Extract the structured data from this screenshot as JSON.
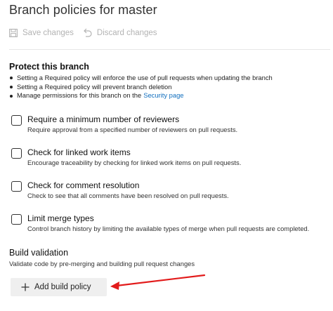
{
  "page": {
    "title": "Branch policies for master"
  },
  "toolbar": {
    "save_label": "Save changes",
    "save_icon": "save-icon",
    "discard_label": "Discard changes",
    "discard_icon": "undo-icon"
  },
  "protect": {
    "title": "Protect this branch",
    "bullets": [
      "Setting a Required policy will enforce the use of pull requests when updating the branch",
      "Setting a Required policy will prevent branch deletion",
      "Manage permissions for this branch on the"
    ],
    "security_link": "Security page"
  },
  "policies": [
    {
      "title": "Require a minimum number of reviewers",
      "description": "Require approval from a specified number of reviewers on pull requests.",
      "checked": false
    },
    {
      "title": "Check for linked work items",
      "description": "Encourage traceability by checking for linked work items on pull requests.",
      "checked": false
    },
    {
      "title": "Check for comment resolution",
      "description": "Check to see that all comments have been resolved on pull requests.",
      "checked": false
    },
    {
      "title": "Limit merge types",
      "description": "Control branch history by limiting the available types of merge when pull requests are completed.",
      "checked": false
    }
  ],
  "build": {
    "title": "Build validation",
    "description": "Validate code by pre-merging and building pull request changes",
    "add_label": "Add build policy",
    "add_icon": "plus-icon"
  },
  "colors": {
    "link": "#106ebe",
    "annotation_arrow": "#e21b1b",
    "disabled_text": "#b3b3b3"
  }
}
